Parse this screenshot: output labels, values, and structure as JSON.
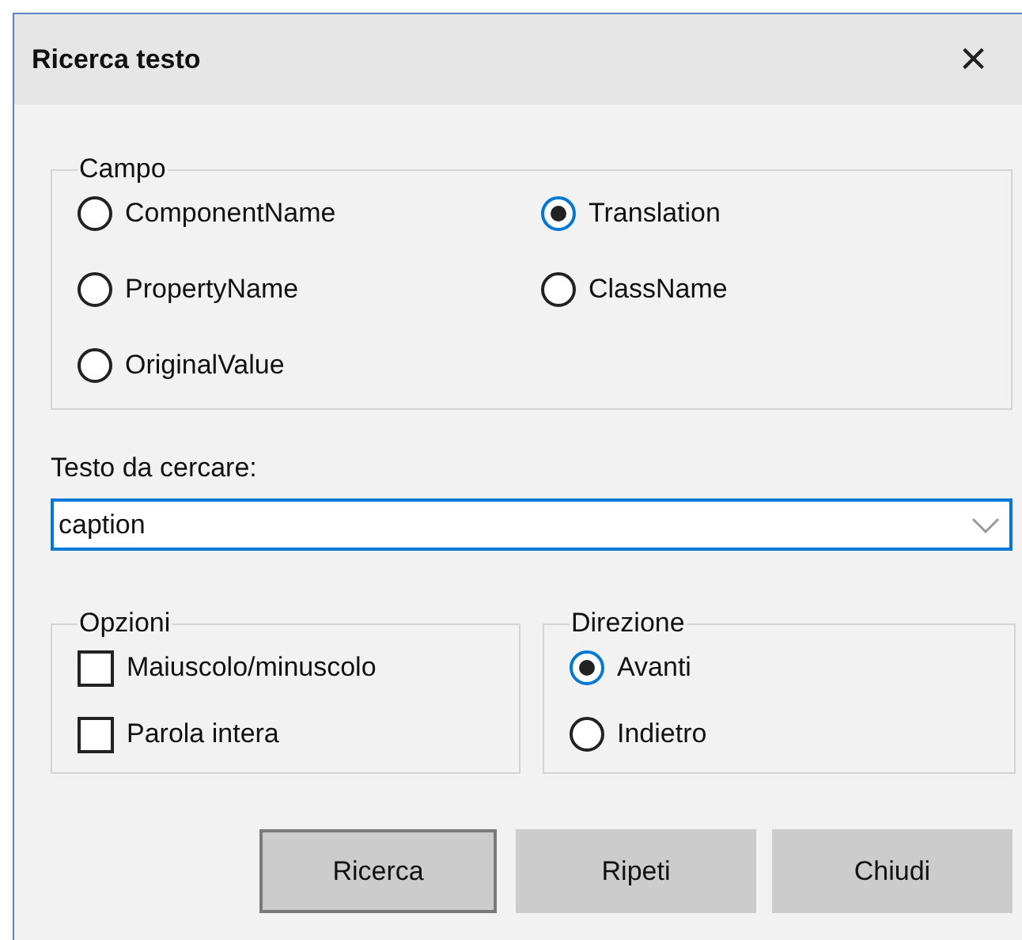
{
  "window": {
    "title": "Ricerca testo",
    "close": "×"
  },
  "campo": {
    "label": "Campo",
    "options": [
      {
        "label": "ComponentName",
        "selected": false
      },
      {
        "label": "Translation",
        "selected": true
      },
      {
        "label": "PropertyName",
        "selected": false
      },
      {
        "label": "ClassName",
        "selected": false
      },
      {
        "label": "OriginalValue",
        "selected": false
      }
    ]
  },
  "search": {
    "label": "Testo da cercare:",
    "value": "caption"
  },
  "opzioni": {
    "label": "Opzioni",
    "options": [
      {
        "label": "Maiuscolo/minuscolo",
        "checked": false
      },
      {
        "label": "Parola intera",
        "checked": false
      }
    ]
  },
  "direzione": {
    "label": "Direzione",
    "options": [
      {
        "label": "Avanti",
        "selected": true
      },
      {
        "label": "Indietro",
        "selected": false
      }
    ]
  },
  "buttons": [
    {
      "label": "Ricerca",
      "default": true
    },
    {
      "label": "Ripeti",
      "default": false
    },
    {
      "label": "Chiudi",
      "default": false
    }
  ]
}
